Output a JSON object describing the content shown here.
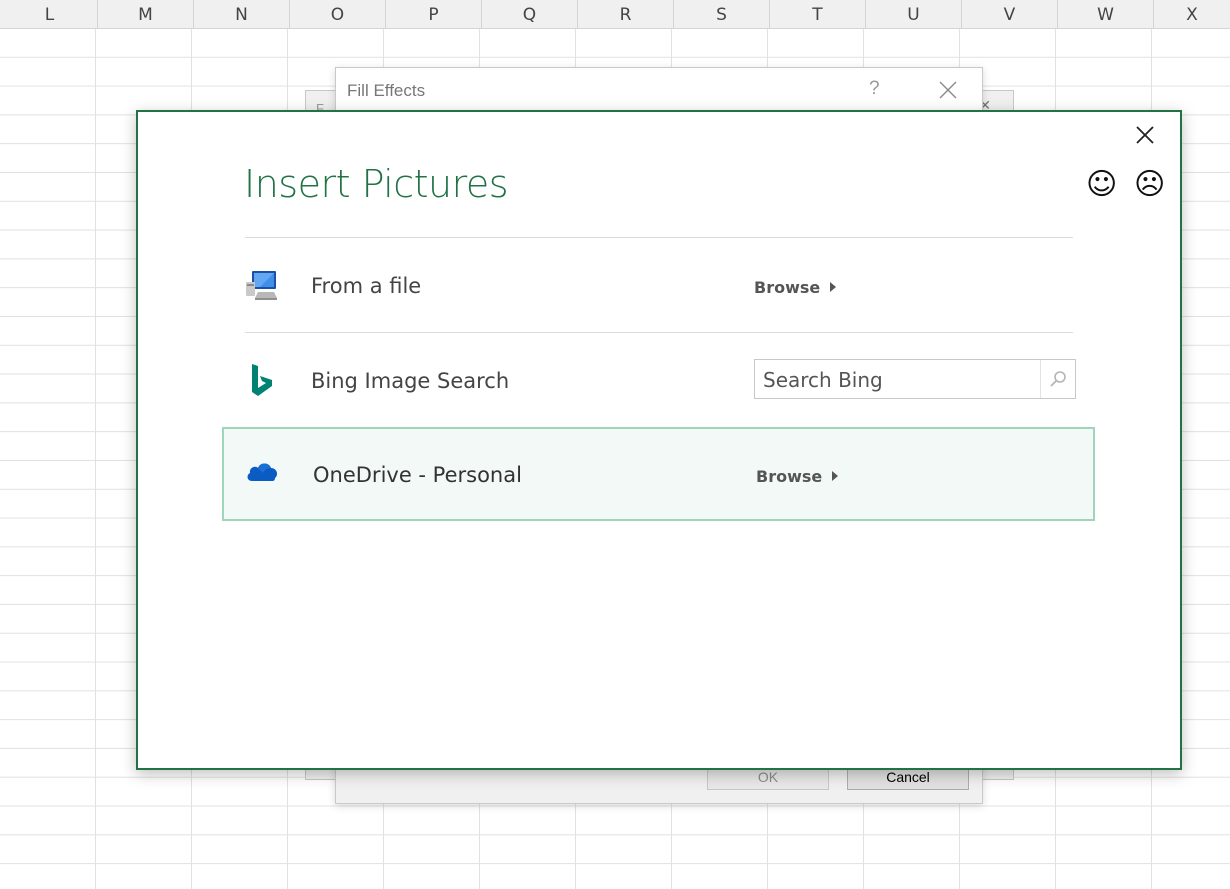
{
  "spreadsheet": {
    "columns": [
      "L",
      "M",
      "N",
      "O",
      "P",
      "Q",
      "R",
      "S",
      "T",
      "U",
      "V",
      "W",
      "X"
    ]
  },
  "fill_effects": {
    "title": "Fill Effects",
    "help": "?",
    "ok_label": "OK",
    "cancel_label": "Cancel",
    "behind_title": "F"
  },
  "insert_pictures": {
    "title": "Insert Pictures",
    "feedback_smile": "☺",
    "feedback_frown": "☹",
    "accent_color": "#217346",
    "sources": [
      {
        "label": "From a file",
        "action": "Browse",
        "icon": "computer-icon"
      },
      {
        "label": "Bing Image Search",
        "icon": "bing-icon",
        "search_placeholder": "Search Bing"
      },
      {
        "label": "OneDrive - Personal",
        "action": "Browse",
        "icon": "onedrive-cloud-icon",
        "selected": true
      }
    ]
  }
}
